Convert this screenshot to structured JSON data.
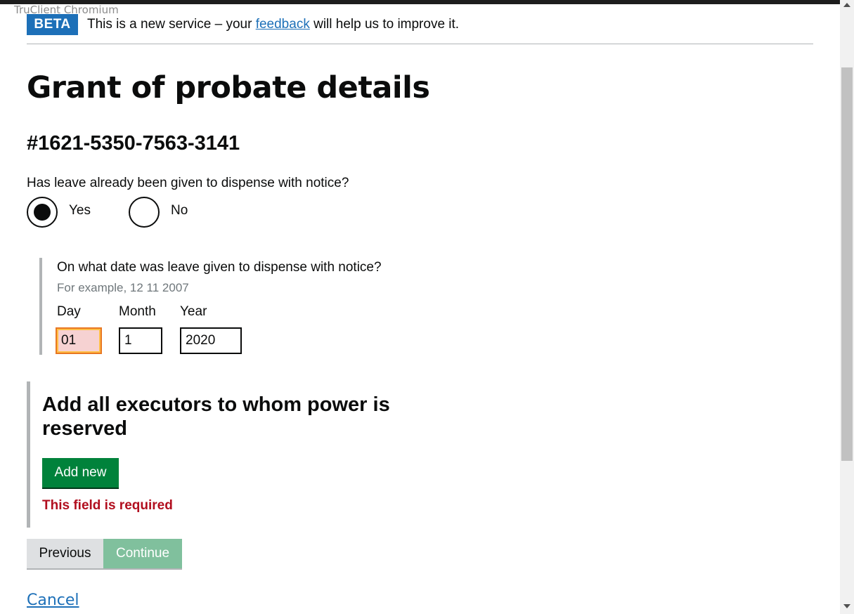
{
  "app_label": "TruClient Chromium",
  "banner": {
    "tag": "BETA",
    "text_before": "This is a new service – your ",
    "link": "feedback",
    "text_after": " will help us to improve it."
  },
  "page_title": "Grant of probate details",
  "case_reference": "#1621-5350-7563-3141",
  "leave_question": {
    "label": "Has leave already been given to dispense with notice?",
    "options": [
      {
        "label": "Yes",
        "selected": true
      },
      {
        "label": "No",
        "selected": false
      }
    ]
  },
  "date_question": {
    "label": "On what date was leave given to dispense with notice?",
    "hint": "For example, 12 11 2007",
    "day": {
      "label": "Day",
      "value": "01"
    },
    "month": {
      "label": "Month",
      "value": "1"
    },
    "year": {
      "label": "Year",
      "value": "2020"
    }
  },
  "executors": {
    "heading": "Add all executors to whom power is reserved",
    "add_button": "Add new",
    "error": "This field is required"
  },
  "nav": {
    "previous": "Previous",
    "continue": "Continue",
    "cancel": "Cancel"
  },
  "colors": {
    "beta_tag": "#1d70b8",
    "link": "#1d70b8",
    "add_button": "#00823b",
    "continue_disabled": "#80c09d",
    "error_text": "#b10e1e",
    "error_field_bg": "#f6d2d2"
  }
}
